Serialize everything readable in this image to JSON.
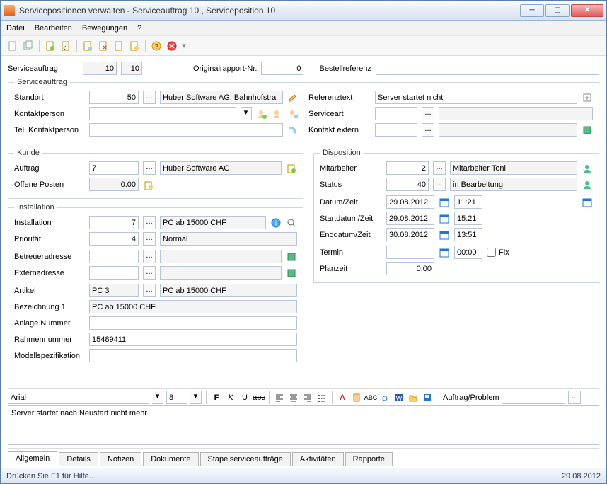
{
  "window": {
    "title": "Servicepositionen verwalten - Serviceauftrag 10 , Serviceposition 10"
  },
  "menu": {
    "datei": "Datei",
    "bearbeiten": "Bearbeiten",
    "bewegungen": "Bewegungen",
    "help": "?"
  },
  "header": {
    "serviceauftrag_lbl": "Serviceauftrag",
    "sa_a": "10",
    "sa_b": "10",
    "originalrapport_lbl": "Originalrapport-Nr.",
    "originalrapport": "0",
    "bestellreferenz_lbl": "Bestellreferenz",
    "bestellreferenz": ""
  },
  "serviceauftrag": {
    "legend": "Serviceauftrag",
    "standort_lbl": "Standort",
    "standort": "50",
    "standort_txt": "Huber Software AG, Bahnhofstra",
    "kontaktperson_lbl": "Kontaktperson",
    "kontaktperson": "",
    "tel_lbl": "Tel. Kontaktperson",
    "tel": "",
    "referenztext_lbl": "Referenztext",
    "referenztext": "Server startet nicht",
    "serviceart_lbl": "Serviceart",
    "serviceart": "",
    "serviceart_txt": "",
    "kontaktextern_lbl": "Kontakt extern",
    "kontaktextern": "",
    "kontaktextern_txt": ""
  },
  "kunde": {
    "legend": "Kunde",
    "auftrag_lbl": "Auftrag",
    "auftrag": "7",
    "auftrag_txt": "Huber Software AG",
    "offene_lbl": "Offene Posten",
    "offene": "0.00"
  },
  "installation": {
    "legend": "Installation",
    "installation_lbl": "Installation",
    "installation": "7",
    "installation_txt": "PC ab 15000 CHF",
    "prioritaet_lbl": "Priorität",
    "prioritaet": "4",
    "prioritaet_txt": "Normal",
    "betreuer_lbl": "Betreueradresse",
    "betreuer": "",
    "betreuer_txt": "",
    "extern_lbl": "Externadresse",
    "extern": "",
    "extern_txt": "",
    "artikel_lbl": "Artikel",
    "artikel": "PC 3",
    "artikel_txt": "PC ab 15000 CHF",
    "bez1_lbl": "Bezeichnung 1",
    "bez1": "PC ab 15000 CHF",
    "anlage_lbl": "Anlage Nummer",
    "anlage": "",
    "rahmen_lbl": "Rahmennummer",
    "rahmen": "15489411",
    "modell_lbl": "Modellspezifikation",
    "modell": ""
  },
  "disposition": {
    "legend": "Disposition",
    "mitarbeiter_lbl": "Mitarbeiter",
    "mitarbeiter": "2",
    "mitarbeiter_txt": "Mitarbeiter Toni",
    "status_lbl": "Status",
    "status": "40",
    "status_txt": "in Bearbeitung",
    "datumzeit_lbl": "Datum/Zeit",
    "datum": "29.08.2012",
    "zeit": "11:21",
    "startdatum_lbl": "Startdatum/Zeit",
    "startdatum": "29.08.2012",
    "startzeit": "15:21",
    "enddatum_lbl": "Enddatum/Zeit",
    "enddatum": "30.08.2012",
    "endzeit": "13:51",
    "termin_lbl": "Termin",
    "termin": "",
    "terminzeit": "00:00",
    "fix_lbl": "Fix",
    "planzeit_lbl": "Planzeit",
    "planzeit": "0.00"
  },
  "rtf": {
    "font": "Arial",
    "size": "8",
    "auftragproblem_lbl": "Auftrag/Problem",
    "auftragproblem": "",
    "body": "Server startet nach Neustart nicht mehr"
  },
  "tabs": {
    "allgemein": "Allgemein",
    "details": "Details",
    "notizen": "Notizen",
    "dokumente": "Dokumente",
    "stapel": "Stapelserviceaufträge",
    "aktivitaeten": "Aktivitäten",
    "rapporte": "Rapporte"
  },
  "status": {
    "hint": "Drücken Sie F1 für Hilfe...",
    "date": "29.08.2012"
  }
}
